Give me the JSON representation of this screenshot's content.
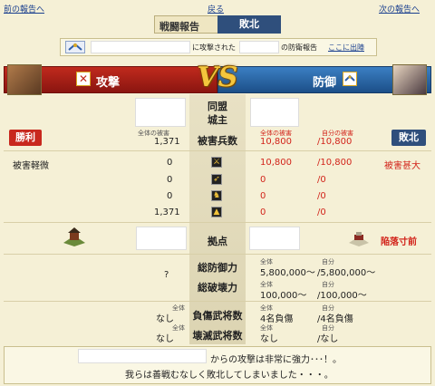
{
  "nav": {
    "prev": "前の報告へ",
    "back": "戻る",
    "next": "次の報告へ"
  },
  "header": {
    "title": "戦闘報告",
    "result": "敗北"
  },
  "summary": {
    "text1": "に攻撃された",
    "text2": "の防衛報告",
    "link": "ここに出陣"
  },
  "sides": {
    "attack": "攻撃",
    "defense": "防御",
    "vs": "VS"
  },
  "rows": {
    "alliance": "同盟",
    "lord": "城主",
    "losses": "被害兵数",
    "base": "拠点",
    "total_defense": "総防御力",
    "total_destroy": "総破壊力",
    "injured_generals": "負傷武将数",
    "destroyed_generals": "壊滅武将数"
  },
  "attacker": {
    "result": "勝利",
    "damage_label": "被害軽微",
    "total_label": "全体の被害",
    "total_losses": "1,371",
    "units": [
      "0",
      "0",
      "0",
      "1,371"
    ],
    "defense_value": "?",
    "injured_label": "全体",
    "injured": "なし",
    "destroyed_label": "全体",
    "destroyed": "なし"
  },
  "defender": {
    "result": "敗北",
    "damage_label": "被害甚大",
    "total_label": "全体の被害",
    "own_label": "自分の被害",
    "total_losses": "10,800",
    "own_losses": "/10,800",
    "units_total": [
      "10,800",
      "0",
      "0",
      "0"
    ],
    "units_own": [
      "/10,800",
      "/0",
      "/0",
      "/0"
    ],
    "base_status": "陥落寸前",
    "def_total_label": "全体",
    "def_own_label": "自分",
    "defense_total": "5,800,000～",
    "defense_own": "/5,800,000～",
    "destroy_total": "100,000～",
    "destroy_own": "/100,000～",
    "injured_total_label": "全体",
    "injured_own_label": "自分",
    "injured_total": "4名負傷",
    "injured_own": "/4名負傷",
    "destroyed_total_label": "全体",
    "destroyed_own_label": "自分",
    "destroyed_total": "なし",
    "destroyed_own": "/なし"
  },
  "message": {
    "line1": "からの攻撃は非常に強力･･･！。",
    "line2": "我らは善戦むなしく敗北してしまいました・・・。"
  }
}
